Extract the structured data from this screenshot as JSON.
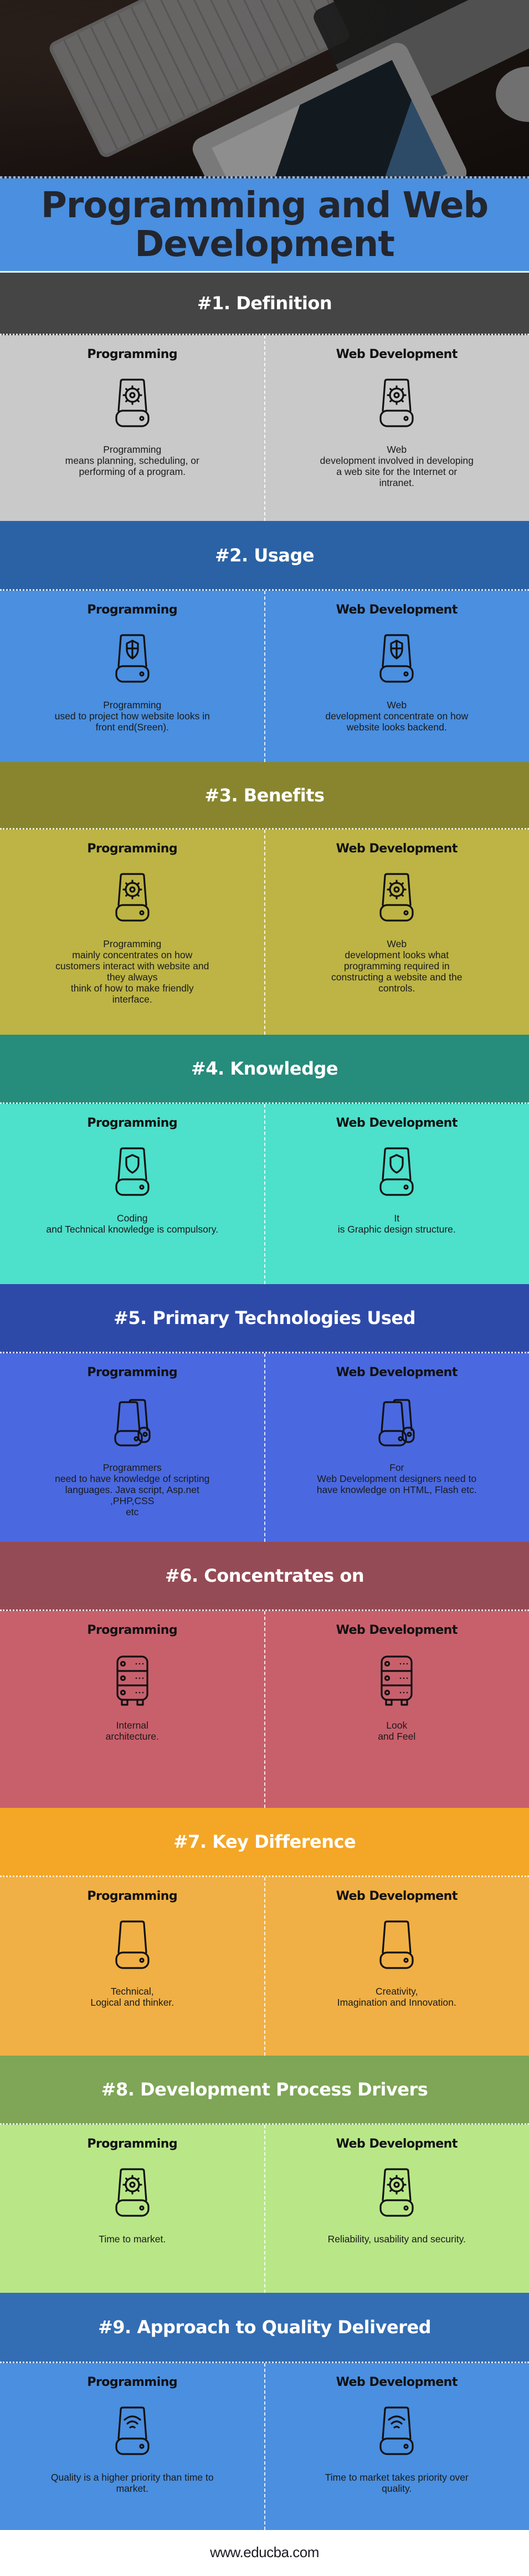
{
  "hero": {
    "image_alt": "Keyboard, laptop, tablet showing a website, and mouse on a wooden desk"
  },
  "title": "Programming and Web Development",
  "column_labels": {
    "left": "Programming",
    "right": "Web Development"
  },
  "sections": [
    {
      "heading": "#1. Definition",
      "icon": "drive-gear-icon",
      "colors": {
        "header": "#454545",
        "body": "#c9c9c9"
      },
      "left_text": "Programming\nmeans planning, scheduling, or\nperforming of a program.",
      "right_text": "Web\ndevelopment involved in developing\na web site for the Internet or\nintranet."
    },
    {
      "heading": "#2. Usage",
      "icon": "drive-shield-cross-icon",
      "colors": {
        "header": "#2a62a5",
        "body": "#4a8fe0"
      },
      "left_text": "Programming\nused to project how website looks in\nfront end(Sreen).",
      "right_text": "Web\ndevelopment concentrate on how\nwebsite looks backend."
    },
    {
      "heading": "#3. Benefits",
      "icon": "drive-gear-icon",
      "colors": {
        "header": "#88852e",
        "body": "#bdb445"
      },
      "left_text": "Programming\nmainly concentrates on how\ncustomers interact with website and\nthey always\nthink of how to make friendly\ninterface.",
      "right_text": "Web\ndevelopment looks what\nprogramming required in\nconstructing a website and the\ncontrols."
    },
    {
      "heading": "#4. Knowledge",
      "icon": "drive-shield-icon",
      "colors": {
        "header": "#268c7c",
        "body": "#4de0cb"
      },
      "left_text": "Coding\nand Technical knowledge is compulsory.",
      "right_text": "It\nis Graphic design structure."
    },
    {
      "heading": "#5. Primary Technologies Used",
      "icon": "double-drive-icon",
      "colors": {
        "header": "#2e4aa9",
        "body": "#4a69e0"
      },
      "left_text": "Programmers\nneed to have knowledge of scripting\nlanguages. Java script, Asp.net\n,PHP,CSS\netc",
      "right_text": "For\nWeb Development designers need to\nhave knowledge on HTML, Flash etc."
    },
    {
      "heading": "#6. Concentrates on",
      "icon": "server-rack-icon",
      "colors": {
        "header": "#954b55",
        "body": "#c8606c"
      },
      "left_text": "Internal\narchitecture.",
      "right_text": "Look\nand Feel"
    },
    {
      "heading": "#7. Key Difference",
      "icon": "drive-icon",
      "colors": {
        "header": "#f4a626",
        "body": "#f0b045"
      },
      "left_text": "Technical,\nLogical and thinker.",
      "right_text": "Creativity,\nImagination and Innovation."
    },
    {
      "heading": "#8. Development Process Drivers",
      "icon": "drive-gear-icon",
      "colors": {
        "header": "#7ea656",
        "body": "#b9e787"
      },
      "left_text": "Time to market.",
      "right_text": "Reliability, usability and security."
    },
    {
      "heading": "#9. Approach to Quality Delivered",
      "icon": "drive-wifi-icon",
      "colors": {
        "header": "#336db3",
        "body": "#4a8fe0"
      },
      "left_text": "Quality is a higher priority than time to\nmarket.",
      "right_text": "Time to market takes priority over\nquality."
    }
  ],
  "footer": {
    "url": "www.educba.com"
  }
}
